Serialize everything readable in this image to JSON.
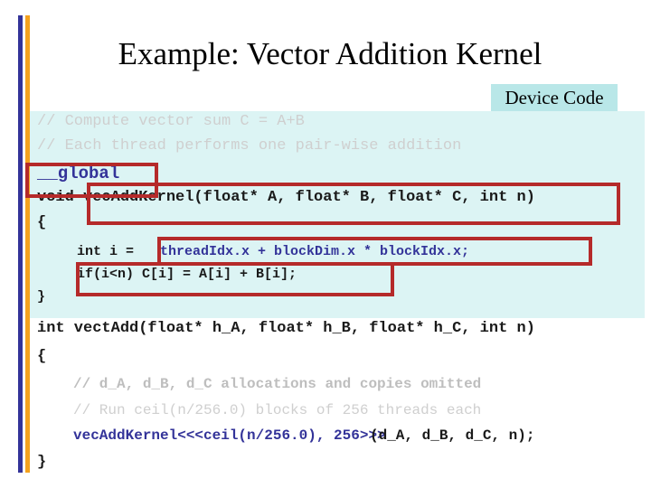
{
  "slide": {
    "title": "Example: Vector Addition Kernel",
    "accent_blue": "#333399",
    "accent_orange": "#F5A21E",
    "panel_bg": "#DCF4F4",
    "callout_bg": "#B9E7E8",
    "annotation_color": "#B52A2A"
  },
  "callout": {
    "device_code_label": "Device Code"
  },
  "device_code": {
    "lines": [
      {
        "text": "// Compute vector sum C = A+B",
        "style": "cmt"
      },
      {
        "text": "// Each thread performs one pair-wise addition",
        "style": "cmt"
      },
      {
        "text": "__global",
        "style": "blu"
      },
      {
        "text": "void vecAddKernel(float* A, float* B, float* C, int n)",
        "style": "blk"
      },
      {
        "text": "{",
        "style": "blk"
      },
      {
        "text": "int i = ",
        "style": "blk"
      },
      {
        "text": "threadIdx.x + blockDim.x * blockIdx.x;",
        "style": "blu"
      },
      {
        "text": "if(i<n) C[i] = A[i] + B[i];",
        "style": "blk"
      },
      {
        "text": "}",
        "style": "blk"
      }
    ]
  },
  "host_code": {
    "lines": [
      {
        "text": "int vectAdd(float* h_A, float* h_B, float* h_C, int n)",
        "style": "blk"
      },
      {
        "text": "{",
        "style": "blk"
      },
      {
        "text": "// d_A, d_B, d_C allocations and copies omitted",
        "style": "cmt-d"
      },
      {
        "text": "// Run ceil(n/256.0) blocks of 256 threads each",
        "style": "cmt"
      },
      {
        "text": "vecAddKernel<<<ceil(n/256.0), 256>>>",
        "style": "blu"
      },
      {
        "text": "(d_A, d_B, d_C, n);",
        "style": "blk"
      },
      {
        "text": "}",
        "style": "blk"
      }
    ]
  },
  "annotations": {
    "boxes": [
      {
        "label": "global-qualifier-highlight"
      },
      {
        "label": "kernel-signature-highlight"
      },
      {
        "label": "thread-index-highlight"
      },
      {
        "label": "bounds-check-highlight"
      }
    ]
  }
}
